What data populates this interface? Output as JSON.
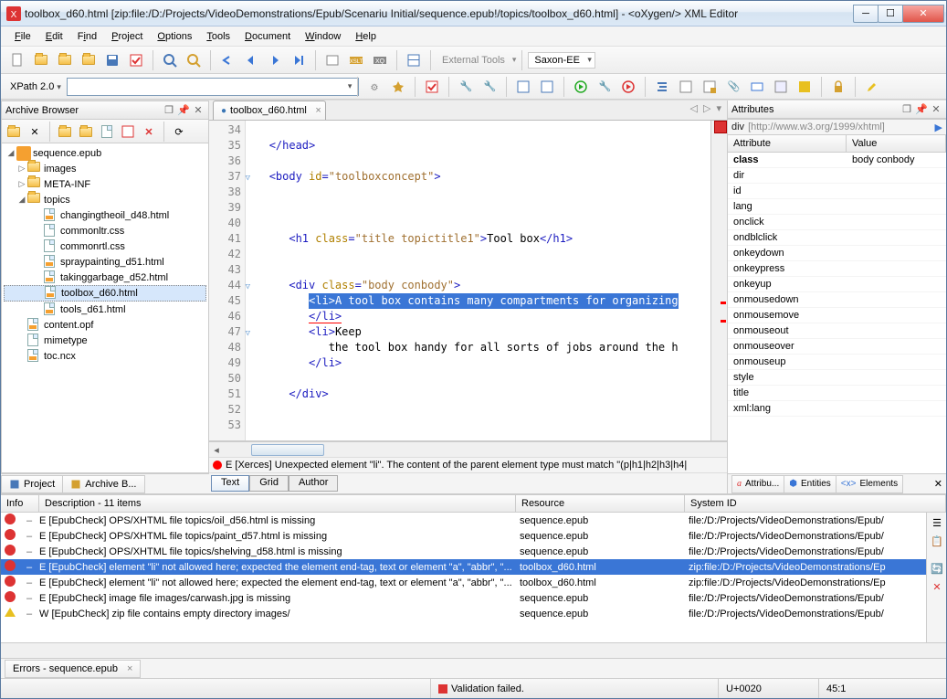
{
  "window": {
    "title": "toolbox_d60.html [zip:file:/D:/Projects/VideoDemonstrations/Epub/Scenariu Initial/sequence.epub!/topics/toolbox_d60.html] - <oXygen/> XML Editor"
  },
  "menu": {
    "items": [
      "File",
      "Edit",
      "Find",
      "Project",
      "Options",
      "Tools",
      "Document",
      "Window",
      "Help"
    ]
  },
  "toolbar2": {
    "xpath_label": "XPath 2.0",
    "ext_tools": "External Tools",
    "saxon": "Saxon-EE"
  },
  "archive": {
    "title": "Archive Browser",
    "root": "sequence.epub",
    "folders": [
      "images",
      "META-INF",
      "topics"
    ],
    "topics": [
      "changingtheoil_d48.html",
      "commonltr.css",
      "commonrtl.css",
      "spraypainting_d51.html",
      "takinggarbage_d52.html",
      "toolbox_d60.html",
      "tools_d61.html"
    ],
    "rootfiles": [
      "content.opf",
      "mimetype",
      "toc.ncx"
    ],
    "selected": "toolbox_d60.html"
  },
  "leftTabs": {
    "project": "Project",
    "archive": "Archive B..."
  },
  "editor": {
    "tab": "toolbox_d60.html",
    "lines": [
      "34",
      "35",
      "36",
      "37",
      "38",
      "39",
      "40",
      "41",
      "42",
      "43",
      "44",
      "45",
      "46",
      "47",
      "48",
      "49",
      "50",
      "51",
      "52",
      "53"
    ],
    "status": "E [Xerces] Unexpected element \"li\". The content of the parent element type must match \"(p|h1|h2|h3|h4|",
    "modes": [
      "Text",
      "Grid",
      "Author"
    ],
    "code": {
      "l35": "</head>",
      "l37_open": "<body ",
      "l37_attr": "id",
      "l37_val": "\"toolboxconcept\"",
      "l37_close": ">",
      "l41_open": "<h1 ",
      "l41_attr": "class",
      "l41_val": "\"title topictitle1\"",
      "l41_mid": ">",
      "l41_txt": "Tool box",
      "l41_close": "</h1>",
      "l44_open": "<div ",
      "l44_attr": "class",
      "l44_val": "\"body conbody\"",
      "l44_close": ">",
      "l45_sel_a": "<li>",
      "l45_sel_b": "A tool box contains many compartments for organizing",
      "l46_err": "</li>",
      "l47_open": "<li>",
      "l47_txt": "Keep",
      "l48_txt": "the tool box handy for all sorts of jobs around the h",
      "l49": "</li>",
      "l51": "</div>"
    }
  },
  "attributes": {
    "title": "Attributes",
    "context_el": "div",
    "context_ns": "[http://www.w3.org/1999/xhtml]",
    "th1": "Attribute",
    "th2": "Value",
    "rows": [
      {
        "name": "class",
        "value": "body conbody",
        "bold": true
      },
      {
        "name": "dir",
        "value": ""
      },
      {
        "name": "id",
        "value": ""
      },
      {
        "name": "lang",
        "value": ""
      },
      {
        "name": "onclick",
        "value": ""
      },
      {
        "name": "ondblclick",
        "value": ""
      },
      {
        "name": "onkeydown",
        "value": ""
      },
      {
        "name": "onkeypress",
        "value": ""
      },
      {
        "name": "onkeyup",
        "value": ""
      },
      {
        "name": "onmousedown",
        "value": ""
      },
      {
        "name": "onmousemove",
        "value": ""
      },
      {
        "name": "onmouseout",
        "value": ""
      },
      {
        "name": "onmouseover",
        "value": ""
      },
      {
        "name": "onmouseup",
        "value": ""
      },
      {
        "name": "style",
        "value": ""
      },
      {
        "name": "title",
        "value": ""
      },
      {
        "name": "xml:lang",
        "value": ""
      }
    ],
    "bottomTabs": [
      "Attribu...",
      "Entities",
      "Elements"
    ]
  },
  "problems": {
    "headers": {
      "info": "Info",
      "desc": "Description - 11 items",
      "res": "Resource",
      "sys": "System ID"
    },
    "rows": [
      {
        "t": "e",
        "desc": "E [EpubCheck] OPS/XHTML file topics/oil_d56.html is missing",
        "res": "sequence.epub",
        "sys": "file:/D:/Projects/VideoDemonstrations/Epub/"
      },
      {
        "t": "e",
        "desc": "E [EpubCheck] OPS/XHTML file topics/paint_d57.html is missing",
        "res": "sequence.epub",
        "sys": "file:/D:/Projects/VideoDemonstrations/Epub/"
      },
      {
        "t": "e",
        "desc": "E [EpubCheck] OPS/XHTML file topics/shelving_d58.html is missing",
        "res": "sequence.epub",
        "sys": "file:/D:/Projects/VideoDemonstrations/Epub/"
      },
      {
        "t": "e",
        "desc": "E [EpubCheck] element \"li\" not allowed here; expected the element end-tag, text or element \"a\", \"abbr\", \"...",
        "res": "toolbox_d60.html",
        "sys": "zip:file:/D:/Projects/VideoDemonstrations/Ep",
        "sel": true
      },
      {
        "t": "e",
        "desc": "E [EpubCheck] element \"li\" not allowed here; expected the element end-tag, text or element \"a\", \"abbr\", \"...",
        "res": "toolbox_d60.html",
        "sys": "zip:file:/D:/Projects/VideoDemonstrations/Ep"
      },
      {
        "t": "e",
        "desc": "E [EpubCheck] image file images/carwash.jpg is missing",
        "res": "sequence.epub",
        "sys": "file:/D:/Projects/VideoDemonstrations/Epub/"
      },
      {
        "t": "w",
        "desc": "W [EpubCheck] zip file contains empty directory images/",
        "res": "sequence.epub",
        "sys": "file:/D:/Projects/VideoDemonstrations/Epub/"
      }
    ],
    "tab": "Errors - sequence.epub"
  },
  "statusbar": {
    "validation": "Validation failed.",
    "unicode": "U+0020",
    "pos": "45:1"
  }
}
